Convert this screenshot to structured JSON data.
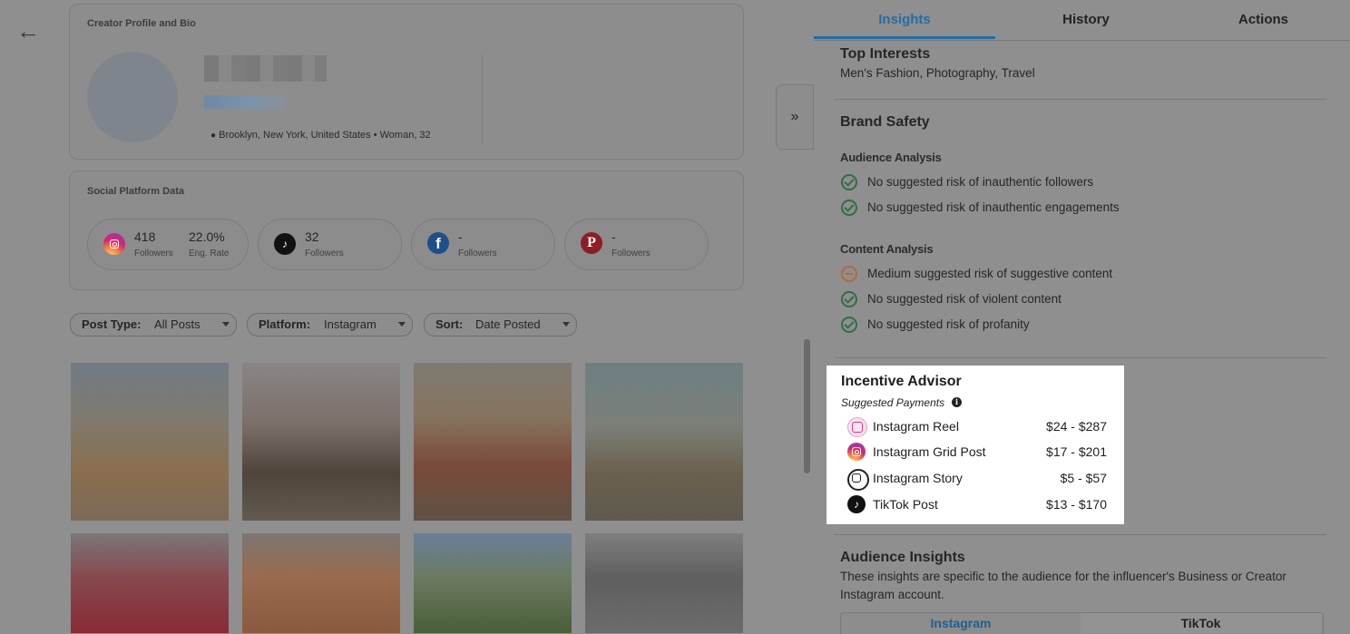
{
  "profile_card": {
    "title": "Creator Profile and Bio",
    "location": "Brooklyn, New York, United States",
    "demographic": "Woman, 32"
  },
  "social_card": {
    "title": "Social Platform Data",
    "platforms": [
      {
        "icon": "instagram-icon",
        "followers": "418",
        "followers_label": "Followers",
        "eng_rate": "22.0%",
        "eng_label": "Eng. Rate"
      },
      {
        "icon": "tiktok-icon",
        "followers": "32",
        "followers_label": "Followers"
      },
      {
        "icon": "facebook-icon",
        "followers": "-",
        "followers_label": "Followers"
      },
      {
        "icon": "pinterest-icon",
        "followers": "-",
        "followers_label": "Followers"
      }
    ]
  },
  "filters": [
    {
      "label": "Post Type:",
      "value": "All Posts"
    },
    {
      "label": "Platform:",
      "value": "Instagram"
    },
    {
      "label": "Sort:",
      "value": "Date Posted"
    }
  ],
  "tabs": [
    "Insights",
    "History",
    "Actions"
  ],
  "active_tab": "Insights",
  "top_interests": {
    "title": "Top Interests",
    "value": "Men's Fashion, Photography, Travel"
  },
  "brand_safety": {
    "title": "Brand Safety",
    "audience_analysis": {
      "title": "Audience Analysis",
      "items": [
        {
          "status": "ok",
          "text": "No suggested risk of inauthentic followers"
        },
        {
          "status": "ok",
          "text": "No suggested risk of inauthentic engagements"
        }
      ]
    },
    "content_analysis": {
      "title": "Content Analysis",
      "items": [
        {
          "status": "medium",
          "text": "Medium suggested risk of suggestive content"
        },
        {
          "status": "ok",
          "text": "No suggested risk of violent content"
        },
        {
          "status": "ok",
          "text": "No suggested risk of profanity"
        }
      ]
    }
  },
  "incentive_advisor": {
    "title": "Incentive Advisor",
    "subtitle": "Suggested Payments",
    "rows": [
      {
        "icon": "instagram-reel-icon",
        "name": "Instagram Reel",
        "price": "$24 - $287"
      },
      {
        "icon": "instagram-icon",
        "name": "Instagram Grid Post",
        "price": "$17 - $201"
      },
      {
        "icon": "instagram-story-icon",
        "name": "Instagram Story",
        "price": "$5 - $57"
      },
      {
        "icon": "tiktok-icon",
        "name": "TikTok Post",
        "price": "$13 - $170"
      }
    ]
  },
  "audience_insights": {
    "title": "Audience Insights",
    "description_line1": "These insights are specific to the audience for the influencer's Business or Creator",
    "description_line2": "Instagram account.",
    "tabs": [
      "Instagram",
      "TikTok"
    ]
  },
  "colors": {
    "accent": "#1f6fa8",
    "ok": "#2f6f45",
    "warning": "#b36a36"
  }
}
